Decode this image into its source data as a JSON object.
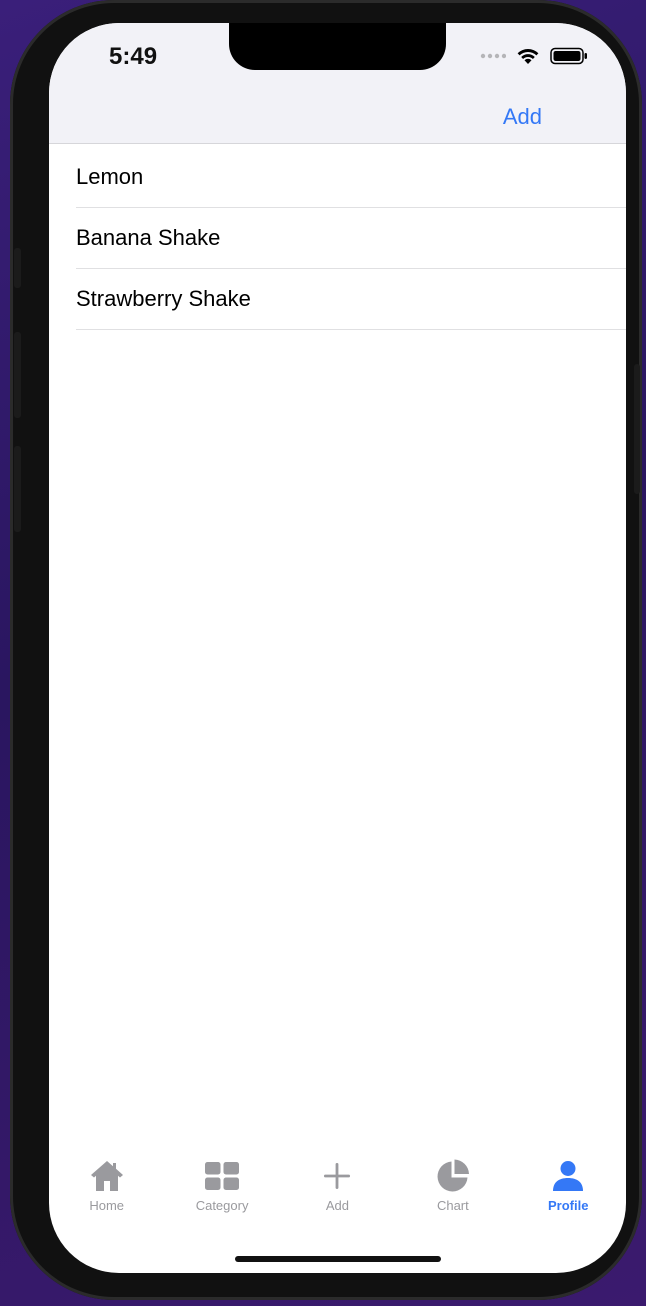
{
  "status": {
    "time": "5:49"
  },
  "nav": {
    "add_label": "Add"
  },
  "list": [
    {
      "label": "Lemon"
    },
    {
      "label": "Banana Shake"
    },
    {
      "label": "Strawberry Shake"
    }
  ],
  "tabs": [
    {
      "label": "Home",
      "icon": "house-icon"
    },
    {
      "label": "Category",
      "icon": "grid-icon"
    },
    {
      "label": "Add",
      "icon": "plus-icon"
    },
    {
      "label": "Chart",
      "icon": "pie-chart-icon"
    },
    {
      "label": "Profile",
      "icon": "person-icon",
      "active": true
    }
  ],
  "colors": {
    "accent": "#3478f6",
    "inactive": "#9a9a9e",
    "bar_bg": "#f2f2f7"
  }
}
